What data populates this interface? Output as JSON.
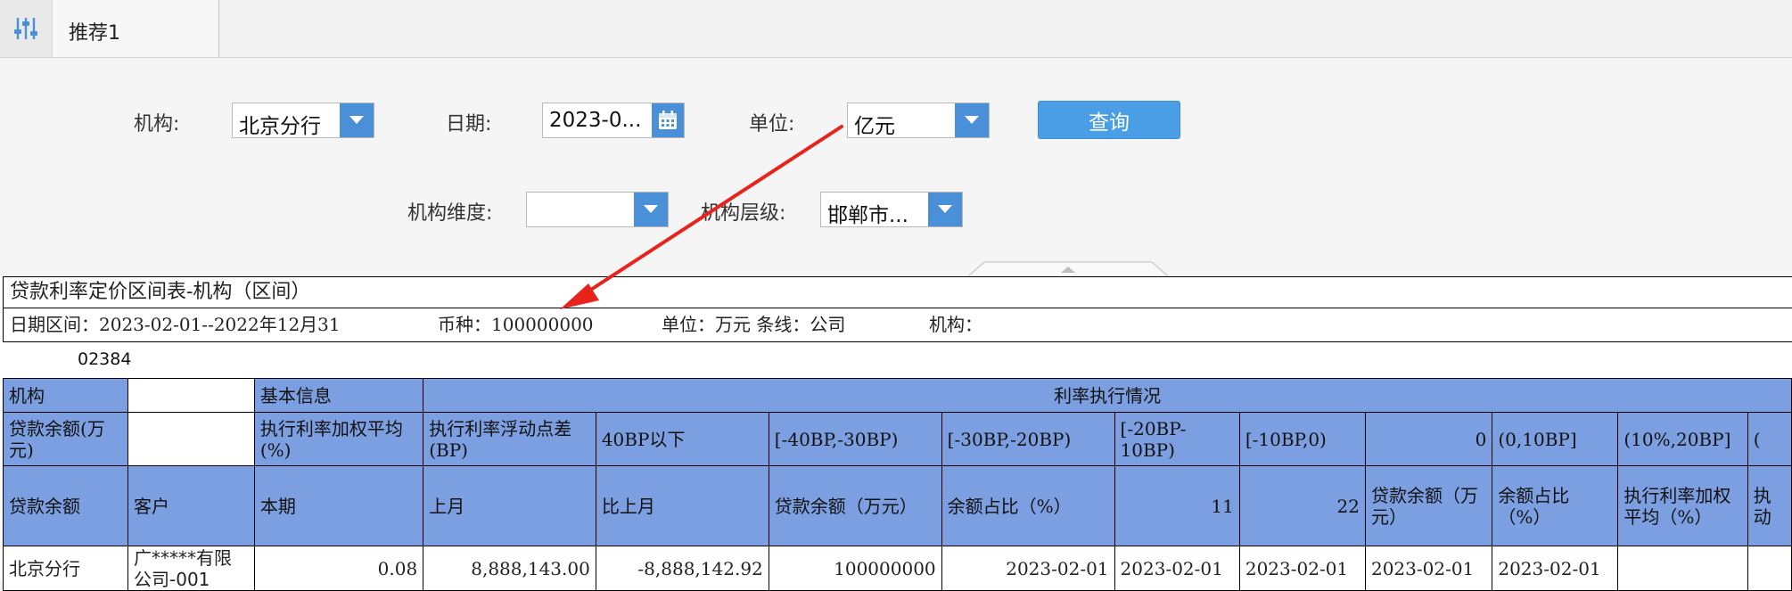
{
  "tab": {
    "label": "推荐1"
  },
  "filters": {
    "org_label": "机构:",
    "org_value": "北京分行",
    "date_label": "日期:",
    "date_value": "2023-0...",
    "unit_label": "单位:",
    "unit_value": "亿元",
    "query_label": "查询",
    "org_dim_label": "机构维度:",
    "org_dim_value": "",
    "org_level_label": "机构层级:",
    "org_level_value": "邯郸市..."
  },
  "report": {
    "title": "贷款利率定价区间表-机构（区间）",
    "info": {
      "date_range": "日期区间：2023-02-01--2022年12月31",
      "currency": "币种：100000000",
      "unit_line": "单位：万元 条线：公司",
      "org": "机构："
    },
    "code": "02384",
    "row1": {
      "c0": "机构",
      "c1": "",
      "c2": "基本信息",
      "c3": "利率执行情况"
    },
    "row2": {
      "c0": "贷款余额(万元)",
      "c1": "",
      "c2": "执行利率加权平均(%)",
      "c3": "执行利率浮动点差(BP)",
      "c4": "40BP以下",
      "c5": "[-40BP,-30BP)",
      "c6": "[-30BP,-20BP)",
      "c7": "[-20BP-10BP)",
      "c8": "[-10BP,0)",
      "c9": "0",
      "c10": "(0,10BP]",
      "c11": "(10%,20BP]",
      "c12": "("
    },
    "row3": {
      "c0": "贷款余额",
      "c1": "客户",
      "c2": "本期",
      "c3": "上月",
      "c4": "比上月",
      "c5": "贷款余额（万元）",
      "c6": "余额占比（%）",
      "c7": "11",
      "c8": "22",
      "c9": "贷款余额（万元）",
      "c10": "余额占比（%）",
      "c11": "执行利率加权平均（%）",
      "c12": "执动"
    },
    "row4": {
      "c0": "北京分行",
      "c1": "广*****有限公司-001",
      "c2": "0.08",
      "c3": "8,888,143.00",
      "c4": "-8,888,142.92",
      "c5": "100000000",
      "c6": "2023-02-01",
      "c7": "2023-02-01",
      "c8": "2023-02-01",
      "c9": "2023-02-01",
      "c10": "2023-02-01",
      "c11": "",
      "c12": ""
    }
  },
  "colors": {
    "header_fill": "#7b9fe0",
    "accent": "#4a90d9",
    "arrow": "#e8231c"
  }
}
